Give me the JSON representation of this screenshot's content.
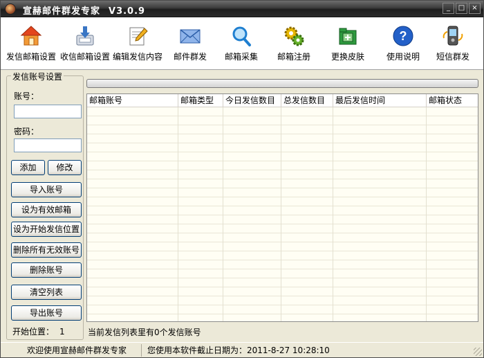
{
  "window": {
    "title": "宣赫邮件群发专家",
    "version": "V3.0.9",
    "minimize_glyph": "_",
    "maximize_glyph": "□",
    "close_glyph": "×"
  },
  "toolbar": {
    "items": [
      {
        "label": "发信邮箱设置",
        "icon": "home-icon"
      },
      {
        "label": "收信邮箱设置",
        "icon": "inbox-download-icon"
      },
      {
        "label": "编辑发信内容",
        "icon": "edit-document-icon"
      },
      {
        "label": "邮件群发",
        "icon": "envelope-icon"
      },
      {
        "label": "邮箱采集",
        "icon": "magnifier-icon"
      },
      {
        "label": "邮箱注册",
        "icon": "gears-icon"
      },
      {
        "label": "更换皮肤",
        "icon": "folder-skin-icon"
      },
      {
        "label": "使用说明",
        "icon": "help-icon"
      },
      {
        "label": "短信群发",
        "icon": "mobile-phone-icon"
      }
    ]
  },
  "account_panel": {
    "legend": "发信账号设置",
    "account_label": "账号：",
    "account_value": "",
    "password_label": "密码：",
    "password_value": "",
    "add_button": "添加",
    "modify_button": "修改",
    "import_button": "导入账号",
    "set_valid_button": "设为有效邮箱",
    "set_start_button": "设为开始发信位置",
    "delete_invalid_button": "删除所有无效账号",
    "delete_button": "删除账号",
    "clear_button": "清空列表",
    "export_button": "导出账号",
    "start_position_label": "开始位置：",
    "start_position_value": "1"
  },
  "account_table": {
    "columns": [
      "邮箱账号",
      "邮箱类型",
      "今日发信数目",
      "总发信数目",
      "最后发信时间",
      "邮箱状态"
    ],
    "rows": []
  },
  "list_status": "当前发信列表里有0个发信账号",
  "statusbar": {
    "welcome": "欢迎使用宣赫邮件群发专家",
    "expiry": "您使用本软件截止日期为：2011-8-27 10:28:10"
  },
  "colors": {
    "titlebar": "#2b2b2b",
    "window_bg": "#ece9d8",
    "grid_row": "#fffef4"
  }
}
